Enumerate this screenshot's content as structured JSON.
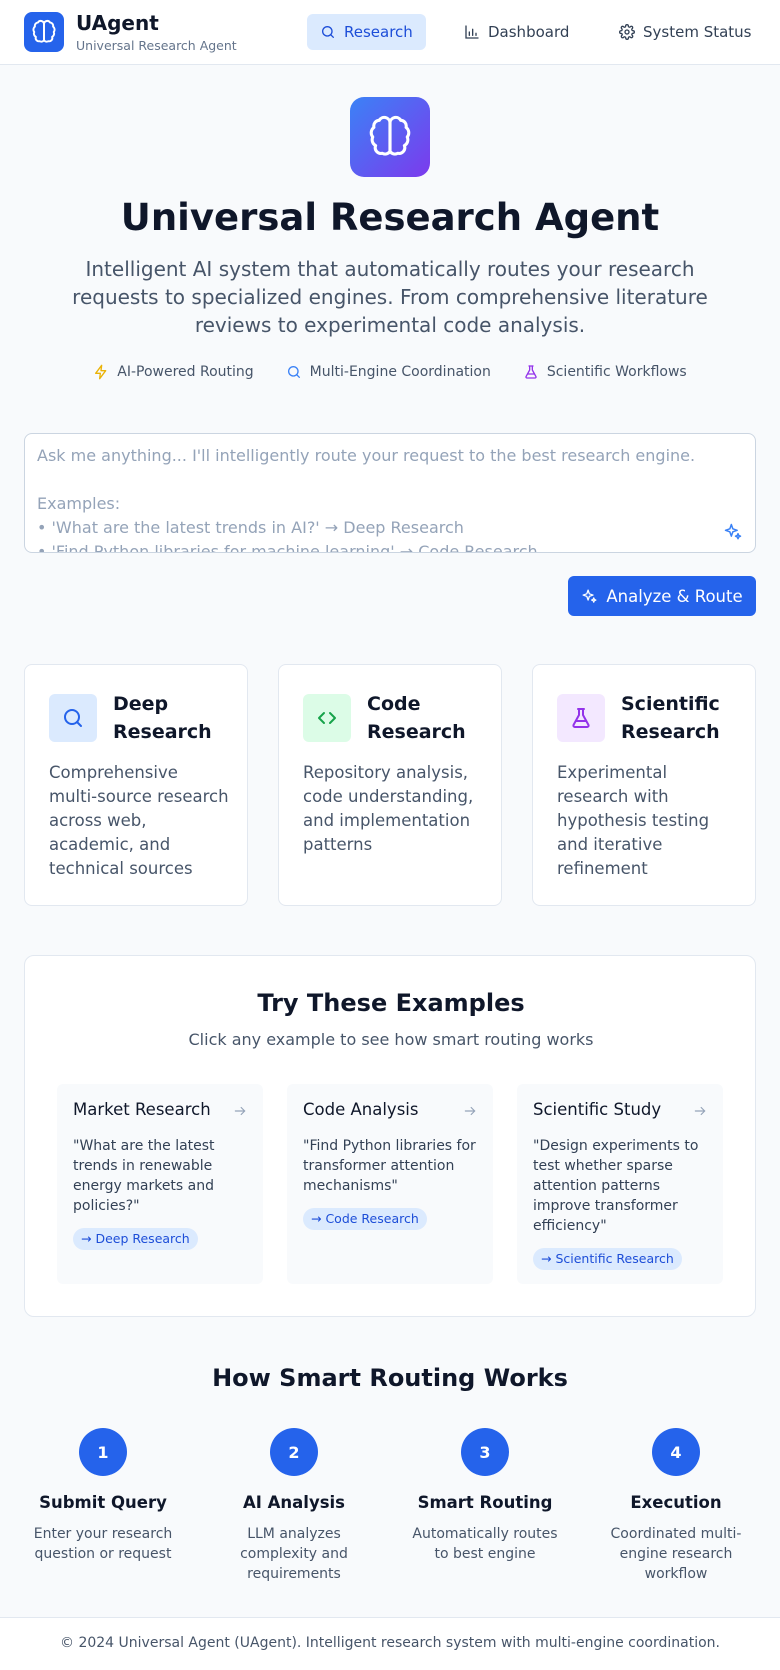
{
  "header": {
    "brand_name": "UAgent",
    "brand_subtitle": "Universal Research Agent",
    "nav": [
      {
        "label": "Research",
        "icon": "search-icon",
        "active": true
      },
      {
        "label": "Dashboard",
        "icon": "bar-chart-icon",
        "active": false
      },
      {
        "label": "System Status",
        "icon": "gear-icon",
        "active": false
      }
    ]
  },
  "hero": {
    "title": "Universal Research Agent",
    "description": "Intelligent AI system that automatically routes your research requests to specialized engines. From comprehensive literature reviews to experimental code analysis.",
    "features": [
      {
        "label": "AI-Powered Routing",
        "icon": "lightning-icon",
        "color": "#eab308"
      },
      {
        "label": "Multi-Engine Coordination",
        "icon": "search-icon",
        "color": "#3b82f6"
      },
      {
        "label": "Scientific Workflows",
        "icon": "flask-icon",
        "color": "#9333ea"
      }
    ]
  },
  "query": {
    "placeholder": "Ask me anything... I'll intelligently route your request to the best research engine.\n\nExamples:\n• 'What are the latest trends in AI?' → Deep Research\n• 'Find Python libraries for machine learning' → Code Research",
    "submit_label": "Analyze & Route"
  },
  "engines": [
    {
      "title": "Deep Research",
      "description": "Comprehensive multi-source research across web, academic, and technical sources",
      "icon": "search-icon",
      "accent": "#2563eb",
      "bg": "#dbeafe"
    },
    {
      "title": "Code Research",
      "description": "Repository analysis, code understanding, and implementation patterns",
      "icon": "code-icon",
      "accent": "#16a34a",
      "bg": "#dcfce7"
    },
    {
      "title": "Scientific Research",
      "description": "Experimental research with hypothesis testing and iterative refinement",
      "icon": "flask-icon",
      "accent": "#9333ea",
      "bg": "#f3e8ff"
    }
  ],
  "examples": {
    "title": "Try These Examples",
    "subtitle": "Click any example to see how smart routing works",
    "items": [
      {
        "title": "Market Research",
        "query": "\"What are the latest trends in renewable energy markets and policies?\"",
        "route": "→ Deep Research"
      },
      {
        "title": "Code Analysis",
        "query": "\"Find Python libraries for transformer attention mechanisms\"",
        "route": "→ Code Research"
      },
      {
        "title": "Scientific Study",
        "query": "\"Design experiments to test whether sparse attention patterns improve transformer efficiency\"",
        "route": "→ Scientific Research"
      }
    ]
  },
  "how": {
    "title": "How Smart Routing Works",
    "steps": [
      {
        "number": "1",
        "title": "Submit Query",
        "description": "Enter your research question or request"
      },
      {
        "number": "2",
        "title": "AI Analysis",
        "description": "LLM analyzes complexity and requirements"
      },
      {
        "number": "3",
        "title": "Smart Routing",
        "description": "Automatically routes to best engine"
      },
      {
        "number": "4",
        "title": "Execution",
        "description": "Coordinated multi-engine research workflow"
      }
    ]
  },
  "footer": {
    "text": "© 2024 Universal Agent (UAgent). Intelligent research system with multi-engine coordination."
  }
}
